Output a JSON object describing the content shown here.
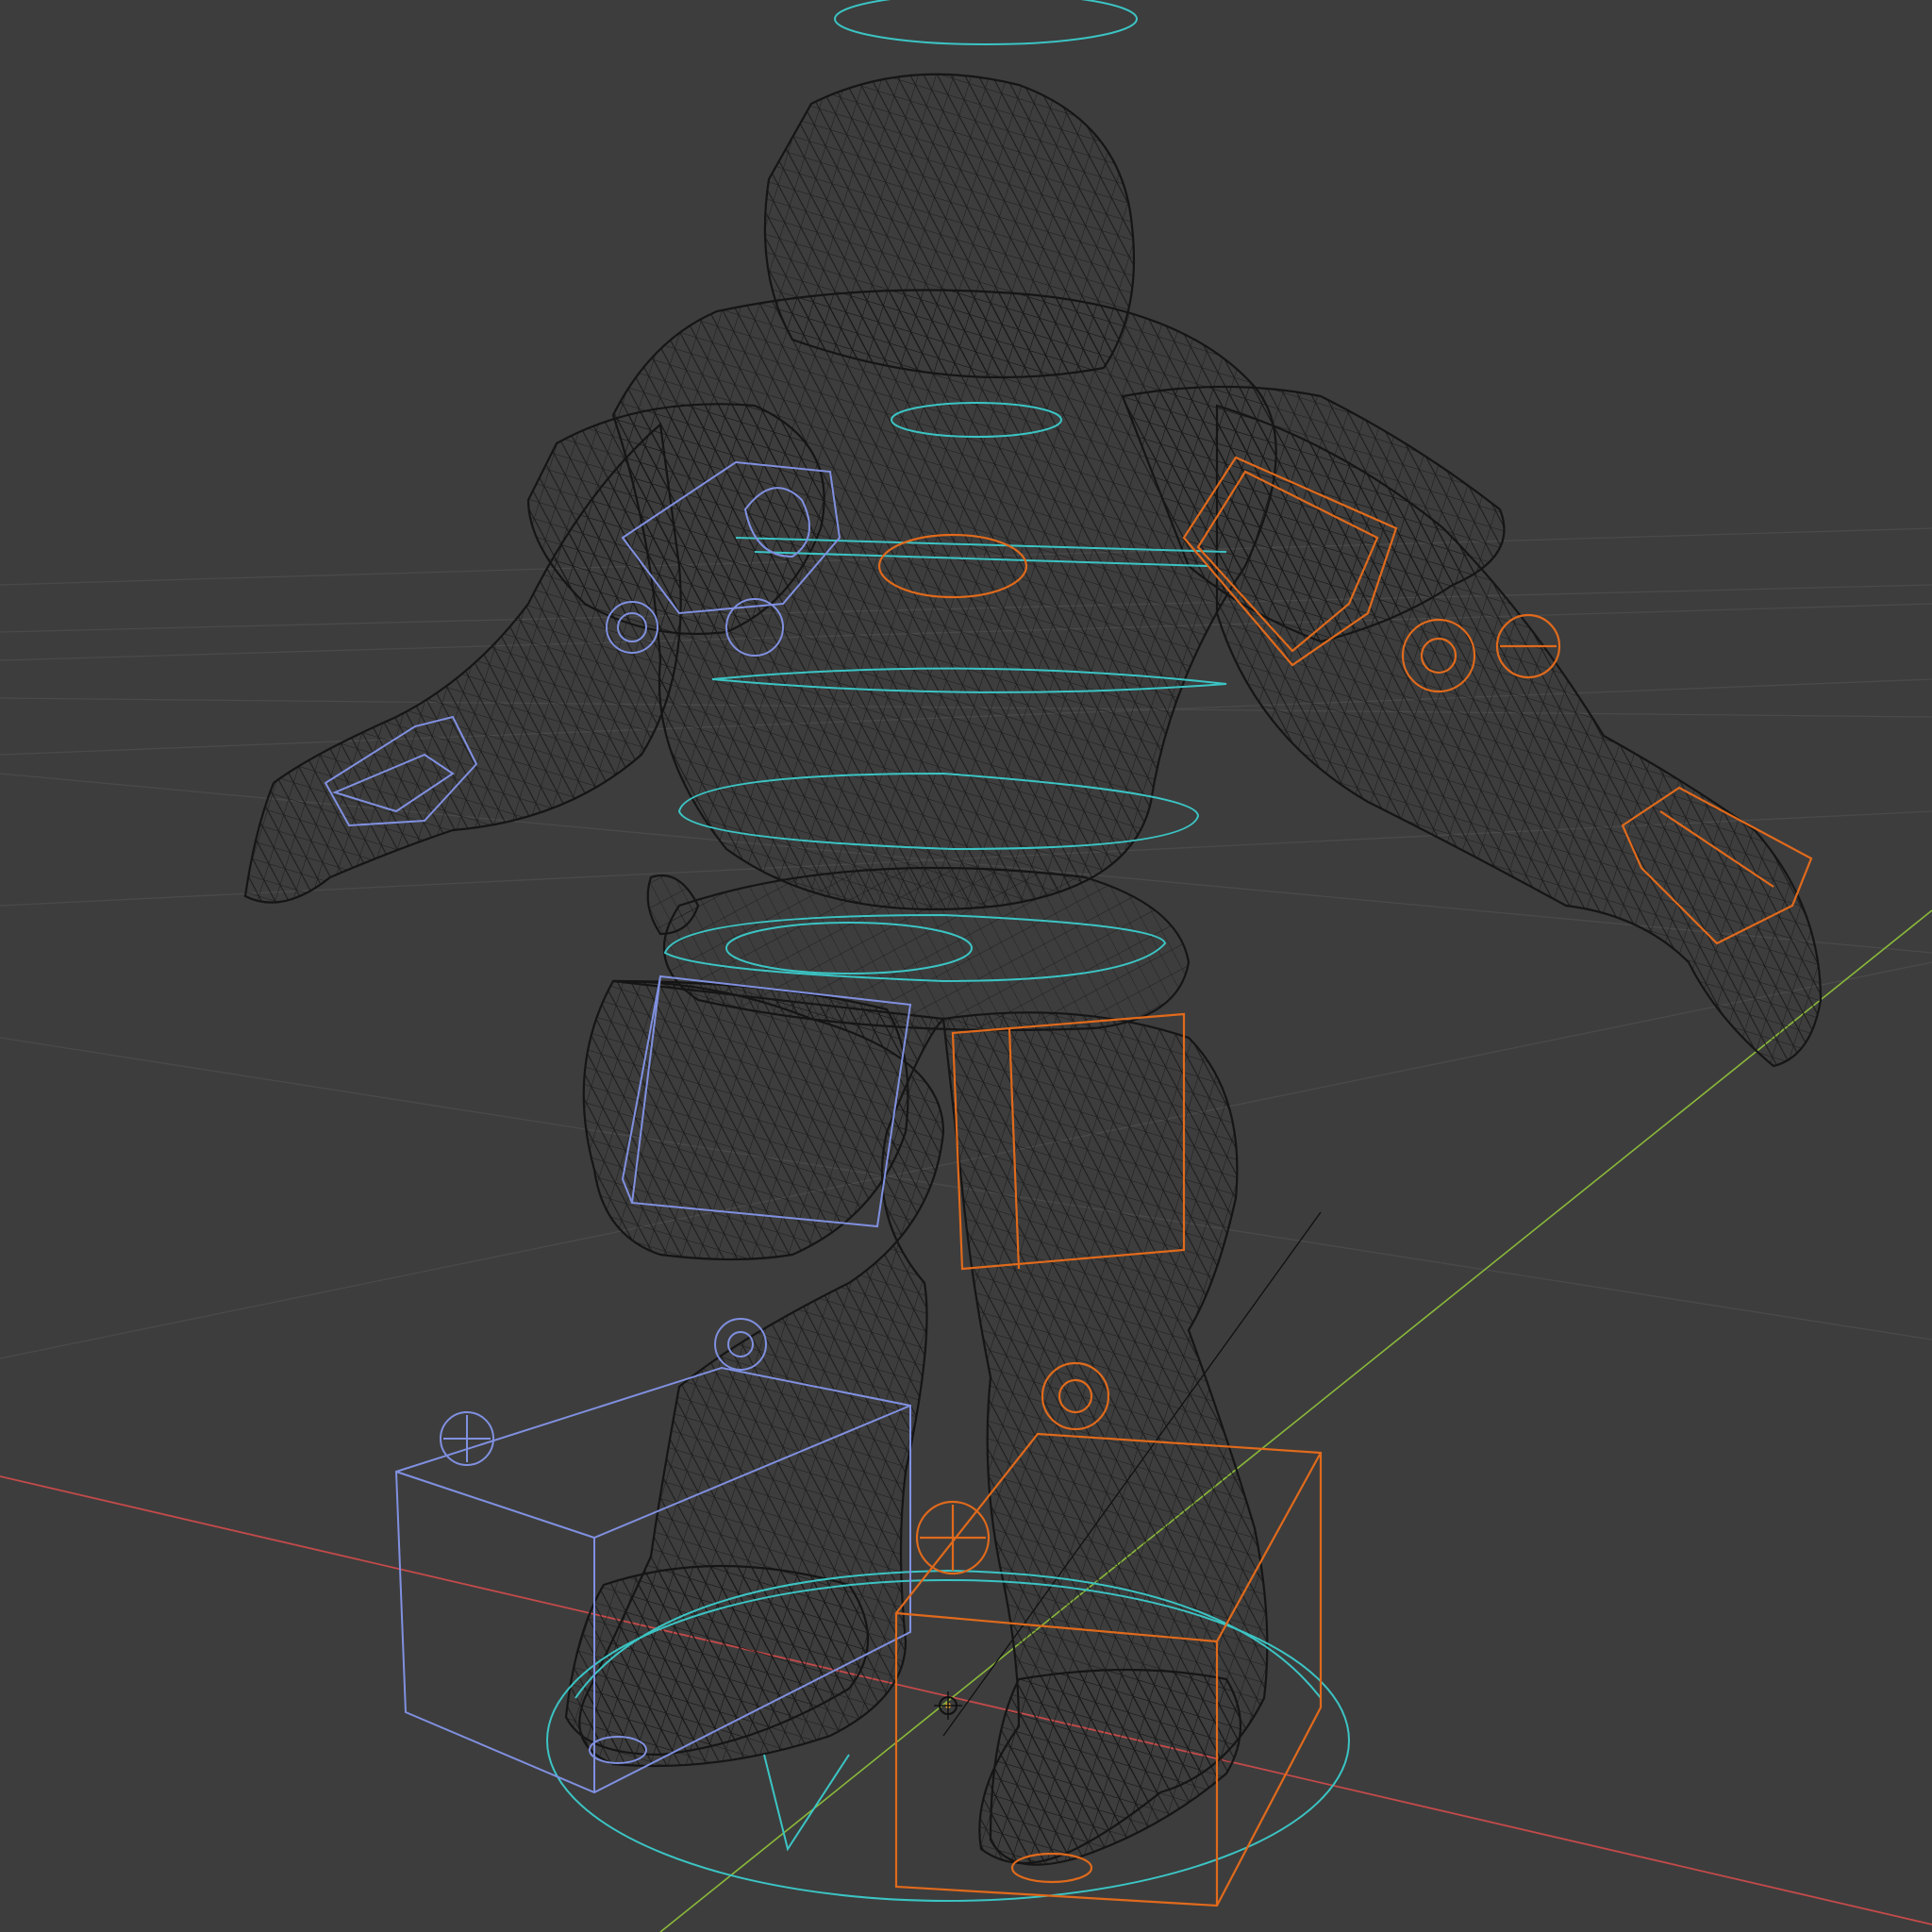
{
  "viewport": {
    "mode": "wireframe",
    "background_color": "#3d3d3d",
    "grid_color": "#4a4a4a",
    "x_axis_color": "#c44a4a",
    "y_axis_color": "#8ab93a",
    "mesh_wire_color": "#151515",
    "left_side_controls_color": "#8090e0",
    "right_side_controls_color": "#e06a1c",
    "center_controls_color": "#3cc4c4"
  },
  "scene": {
    "mesh": "armored-character",
    "rig_controls_left": [
      "shoulder-box-control",
      "elbow-circle-control",
      "hand-box-control",
      "thigh-box-control",
      "knee-circle-control",
      "foot-box-control",
      "heel-sphere-control"
    ],
    "rig_controls_right": [
      "shoulder-box-control",
      "elbow-circle-control",
      "hand-box-control",
      "thigh-box-control",
      "knee-circle-control",
      "foot-box-control",
      "heel-sphere-control"
    ],
    "rig_controls_center": [
      "head-ring-control",
      "neck-ring-control",
      "chest-ring-control",
      "spine-ring-control",
      "waist-ring-control",
      "hip-ring-control",
      "root-ring-control"
    ],
    "origin_marker": "3d-cursor-icon"
  }
}
